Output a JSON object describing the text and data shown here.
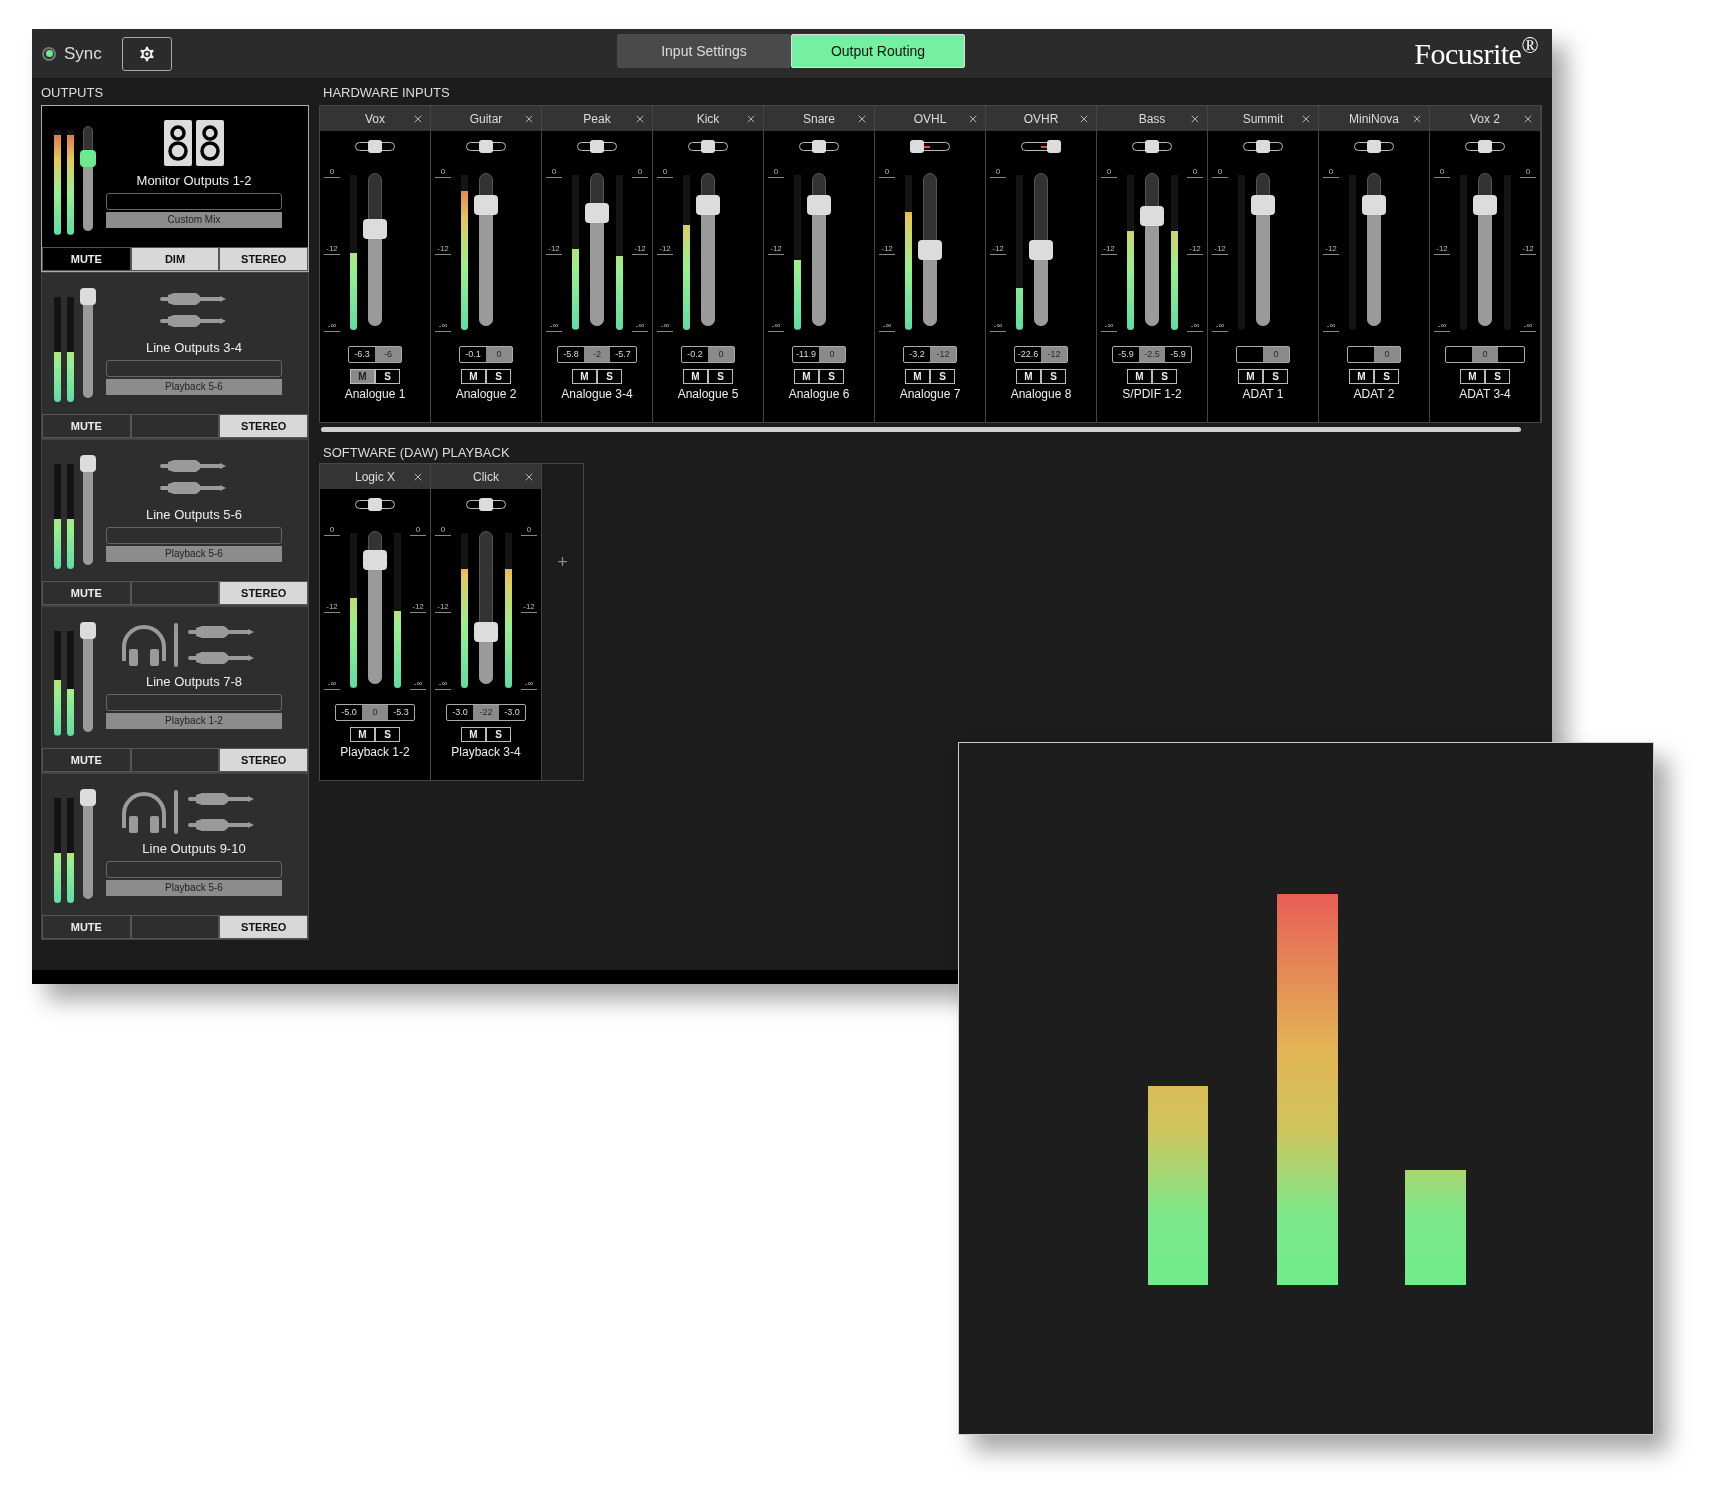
{
  "top_bar": {
    "sync": {
      "label": "Sync",
      "locked": true
    },
    "tabs": [
      {
        "label": "Input Settings",
        "selected": false
      },
      {
        "label": "Output Routing",
        "selected": true
      }
    ],
    "logo": "Focusrite$^{®}$"
  },
  "outputs": {
    "title": "OUTPUTS",
    "items": [
      {
        "name": "Monitor Outputs 1-2",
        "source": "Custom Mix",
        "kind": "speakers",
        "selected": true,
        "fader": {
          "level": 0.7
        },
        "meters": [
          {
            "level": 0.95
          },
          {
            "level": 0.95
          }
        ],
        "buttons": [
          {
            "kind": "mute",
            "label": "MUTE",
            "on": false
          },
          {
            "kind": "dim",
            "label": "DIM",
            "on": true
          },
          {
            "kind": "stereo",
            "label": "STEREO",
            "on": true
          }
        ]
      },
      {
        "name": "Line Outputs 3-4",
        "source": "Playback 5-6",
        "kind": "line",
        "selected": false,
        "fader": {
          "level": 1
        },
        "meters": [
          {
            "level": 0.48
          },
          {
            "level": 0.48
          }
        ],
        "buttons": [
          {
            "kind": "mute",
            "label": "MUTE",
            "on": false
          },
          {
            "kind": "stereo",
            "label": "STEREO",
            "on": true
          }
        ]
      },
      {
        "name": "Line Outputs 5-6",
        "source": "Playback 5-6",
        "kind": "line",
        "selected": false,
        "fader": {
          "level": 1
        },
        "meters": [
          {
            "level": 0.48
          },
          {
            "level": 0.48
          }
        ],
        "buttons": [
          {
            "kind": "mute",
            "label": "MUTE",
            "on": false
          },
          {
            "kind": "stereo",
            "label": "STEREO",
            "on": true
          }
        ]
      },
      {
        "name": "Line Outputs 7-8",
        "source": "Playback 1-2",
        "kind": "headphones",
        "selected": false,
        "fader": {
          "level": 1
        },
        "meters": [
          {
            "level": 0.53
          },
          {
            "level": 0.45
          }
        ],
        "buttons": [
          {
            "kind": "mute",
            "label": "MUTE",
            "on": false
          },
          {
            "kind": "stereo",
            "label": "STEREO",
            "on": true
          }
        ]
      },
      {
        "name": "Line Outputs 9-10",
        "source": "Playback 5-6",
        "kind": "headphones",
        "selected": false,
        "fader": {
          "level": 1
        },
        "meters": [
          {
            "level": 0.48
          },
          {
            "level": 0.48
          }
        ],
        "buttons": [
          {
            "kind": "mute",
            "label": "MUTE",
            "on": false
          },
          {
            "kind": "stereo",
            "label": "STEREO",
            "on": true
          }
        ]
      }
    ]
  },
  "hardware_inputs": {
    "title": "HARDWARE INPUTS",
    "channels": [
      {
        "name": "Vox",
        "source": "Analogue 1",
        "stereo": false,
        "pan": {
          "level": 0.5
        },
        "fader": {
          "level": 0.64
        },
        "meters": [
          {
            "level": 0.5
          }
        ],
        "peaks": [
          "-6.3"
        ],
        "gain": "-6",
        "scales": [
          [
            "0",
            "-12",
            "-∞"
          ]
        ],
        "buttons": [
          {
            "label": "M",
            "on": true
          },
          {
            "label": "S",
            "on": false
          }
        ]
      },
      {
        "name": "Guitar",
        "source": "Analogue 2",
        "stereo": false,
        "pan": {
          "level": 0.5
        },
        "fader": {
          "level": 0.81
        },
        "meters": [
          {
            "level": 0.9
          }
        ],
        "peaks": [
          "-0.1"
        ],
        "gain": "0",
        "scales": [
          [
            "0",
            "-12",
            "-∞"
          ]
        ],
        "buttons": [
          {
            "label": "M",
            "on": false
          },
          {
            "label": "S",
            "on": false
          }
        ]
      },
      {
        "name": "Peak",
        "source": "Analogue 3-4",
        "stereo": true,
        "pan": {
          "level": 0.5
        },
        "fader": {
          "level": 0.75
        },
        "meters": [
          {
            "level": 0.52
          },
          {
            "level": 0.48
          }
        ],
        "peaks": [
          "-5.8",
          "-5.7"
        ],
        "gain": "-2",
        "scales": [
          [
            "0",
            "-12",
            "-∞"
          ],
          [
            "0",
            "-12",
            "-∞"
          ]
        ],
        "buttons": [
          {
            "label": "M",
            "on": false
          },
          {
            "label": "S",
            "on": false
          }
        ]
      },
      {
        "name": "Kick",
        "source": "Analogue 5",
        "stereo": false,
        "pan": {
          "level": 0.5
        },
        "fader": {
          "level": 0.81
        },
        "meters": [
          {
            "level": 0.68
          }
        ],
        "peaks": [
          "-0.2"
        ],
        "gain": "0",
        "scales": [
          [
            "0",
            "-12",
            "-∞"
          ]
        ],
        "buttons": [
          {
            "label": "M",
            "on": false
          },
          {
            "label": "S",
            "on": false
          }
        ]
      },
      {
        "name": "Snare",
        "source": "Analogue 6",
        "stereo": false,
        "pan": {
          "level": 0.5
        },
        "fader": {
          "level": 0.81
        },
        "meters": [
          {
            "level": 0.45
          }
        ],
        "peaks": [
          "-11.9"
        ],
        "gain": "0",
        "scales": [
          [
            "0",
            "-12",
            "-∞"
          ]
        ],
        "buttons": [
          {
            "label": "M",
            "on": false
          },
          {
            "label": "S",
            "on": false
          }
        ]
      },
      {
        "name": "OVHL",
        "source": "Analogue 7",
        "stereo": false,
        "pan": {
          "level": 0
        },
        "fader": {
          "level": 0.5
        },
        "meters": [
          {
            "level": 0.76
          }
        ],
        "peaks": [
          "-3.2"
        ],
        "gain": "-12",
        "scales": [
          [
            "0",
            "-12",
            "-∞"
          ]
        ],
        "buttons": [
          {
            "label": "M",
            "on": false
          },
          {
            "label": "S",
            "on": false
          }
        ]
      },
      {
        "name": "OVHR",
        "source": "Analogue 8",
        "stereo": false,
        "pan": {
          "level": 1
        },
        "fader": {
          "level": 0.5
        },
        "meters": [
          {
            "level": 0.27
          }
        ],
        "peaks": [
          "-22.6"
        ],
        "gain": "-12",
        "scales": [
          [
            "0",
            "-12",
            "-∞"
          ]
        ],
        "buttons": [
          {
            "label": "M",
            "on": false
          },
          {
            "label": "S",
            "on": false
          }
        ]
      },
      {
        "name": "Bass",
        "source": "S/PDIF 1-2",
        "stereo": true,
        "pan": {
          "level": 0.5
        },
        "fader": {
          "level": 0.73
        },
        "meters": [
          {
            "level": 0.64
          },
          {
            "level": 0.64
          }
        ],
        "peaks": [
          "-5.9",
          "-5.9"
        ],
        "gain": "-2.5",
        "scales": [
          [
            "0",
            "-12",
            "-∞"
          ],
          [
            "0",
            "-12",
            "-∞"
          ]
        ],
        "buttons": [
          {
            "label": "M",
            "on": false
          },
          {
            "label": "S",
            "on": false
          }
        ]
      },
      {
        "name": "Summit",
        "source": "ADAT 1",
        "stereo": false,
        "pan": {
          "level": 0.5
        },
        "fader": {
          "level": 0.81
        },
        "gain": "0",
        "scales": [
          [
            "0",
            "-12",
            "-∞"
          ]
        ],
        "buttons": [
          {
            "label": "M",
            "on": false
          },
          {
            "label": "S",
            "on": false
          }
        ]
      },
      {
        "name": "MiniNova",
        "source": "ADAT 2",
        "stereo": false,
        "pan": {
          "level": 0.5
        },
        "fader": {
          "level": 0.81
        },
        "gain": "0",
        "scales": [
          [
            "0",
            "-12",
            "-∞"
          ]
        ],
        "buttons": [
          {
            "label": "M",
            "on": false
          },
          {
            "label": "S",
            "on": false
          }
        ]
      },
      {
        "name": "Vox 2",
        "source": "ADAT 3-4",
        "stereo": true,
        "pan": {
          "level": 0.5
        },
        "fader": {
          "level": 0.81
        },
        "gain": "0",
        "scales": [
          [
            "0",
            "-12",
            "-∞"
          ],
          [
            "0",
            "-12",
            "-∞"
          ]
        ],
        "buttons": [
          {
            "label": "M",
            "on": false
          },
          {
            "label": "S",
            "on": false
          }
        ]
      }
    ]
  },
  "software_playback": {
    "title": "SOFTWARE (DAW) PLAYBACK",
    "add_label": "+",
    "channels": [
      {
        "name": "Logic X",
        "source": "Playback 1-2",
        "stereo": true,
        "pan": {
          "level": 0.5
        },
        "fader": {
          "level": 0.83
        },
        "meters": [
          {
            "level": 0.58
          },
          {
            "level": 0.5
          }
        ],
        "peaks": [
          "-5.0",
          "-5.3"
        ],
        "gain": "0",
        "scales": [
          [
            "0",
            "-12",
            "-∞"
          ],
          [
            "0",
            "-12",
            "-∞"
          ]
        ],
        "buttons": [
          {
            "label": "M",
            "on": false
          },
          {
            "label": "S",
            "on": false
          }
        ]
      },
      {
        "name": "Click",
        "source": "Playback 3-4",
        "stereo": true,
        "pan": {
          "level": 0.5
        },
        "fader": {
          "level": 0.33
        },
        "meters": [
          {
            "level": 0.77
          },
          {
            "level": 0.77
          }
        ],
        "peaks": [
          "-3.0",
          "-3.0"
        ],
        "gain": "-22",
        "scales": [
          [
            "0",
            "-12",
            "-∞"
          ],
          [
            "0",
            "-12",
            "-∞"
          ]
        ],
        "buttons": [
          {
            "label": "M",
            "on": false
          },
          {
            "label": "S",
            "on": false
          }
        ]
      }
    ]
  }
}
